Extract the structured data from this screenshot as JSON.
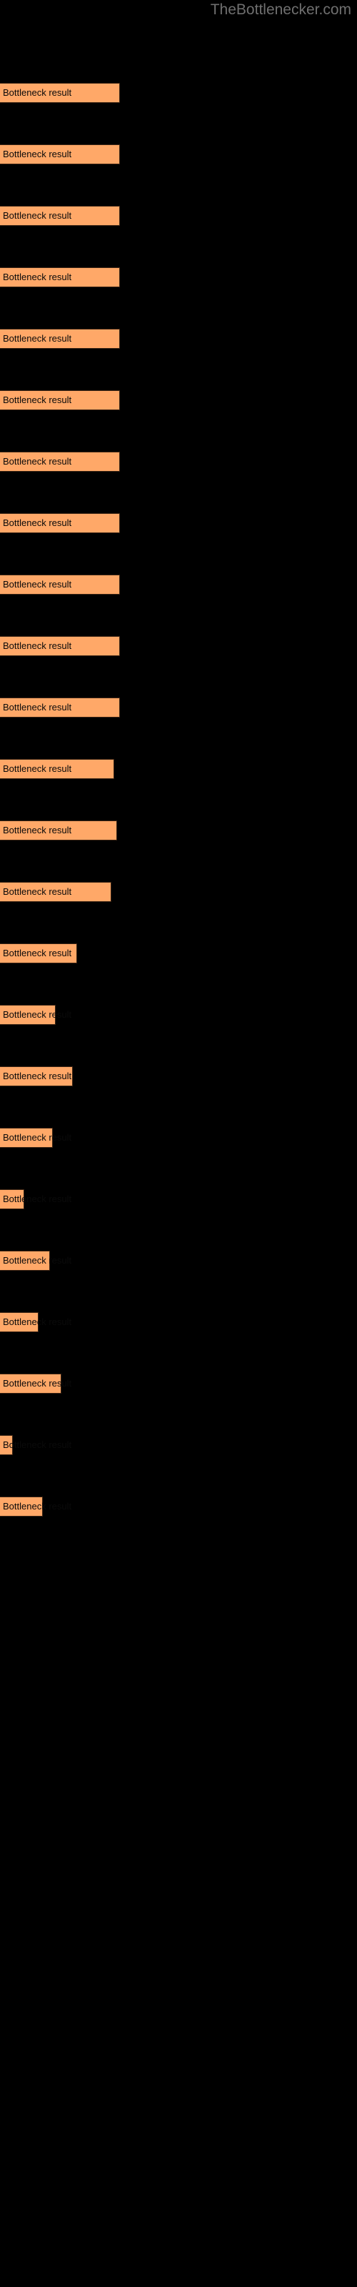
{
  "site": {
    "title": "TheBottlenecker.com",
    "title_color": "#6f6f6f",
    "background_color": "#000000"
  },
  "chart_data": {
    "type": "bar",
    "title": "",
    "subtitle": "",
    "xlabel": "",
    "ylabel": "",
    "orientation": "horizontal",
    "grid": false,
    "legend": null,
    "bar_color": "#ffa868",
    "bar_border_color": "#3a2414",
    "label_color": "#0a0a0a",
    "xlim": [
      0,
      500
    ],
    "categories": [
      "Bottleneck result",
      "Bottleneck result",
      "Bottleneck result",
      "Bottleneck result",
      "Bottleneck result",
      "Bottleneck result",
      "Bottleneck result",
      "Bottleneck result",
      "Bottleneck result",
      "Bottleneck result",
      "Bottleneck result",
      "Bottleneck result",
      "Bottleneck result",
      "Bottleneck result",
      "Bottleneck result",
      "Bottleneck result",
      "Bottleneck result",
      "Bottleneck result",
      "Bottleneck result",
      "Bottleneck result",
      "Bottleneck result",
      "Bottleneck result",
      "Bottleneck result",
      "Bottleneck result"
    ],
    "values": [
      84,
      84,
      84,
      84,
      84,
      84,
      84,
      84,
      84,
      84,
      84,
      80,
      82,
      78,
      54,
      39,
      51,
      37,
      17,
      35,
      27,
      43,
      9,
      30
    ],
    "bars": [
      {
        "label": "Bottleneck result",
        "width": 84,
        "y": 58
      },
      {
        "label": "Bottleneck result",
        "width": 84,
        "y": 101
      },
      {
        "label": "Bottleneck result",
        "width": 84,
        "y": 144
      },
      {
        "label": "Bottleneck result",
        "width": 84,
        "y": 187
      },
      {
        "label": "Bottleneck result",
        "width": 84,
        "y": 230
      },
      {
        "label": "Bottleneck result",
        "width": 84,
        "y": 273
      },
      {
        "label": "Bottleneck result",
        "width": 84,
        "y": 316
      },
      {
        "label": "Bottleneck result",
        "width": 84,
        "y": 359
      },
      {
        "label": "Bottleneck result",
        "width": 84,
        "y": 402
      },
      {
        "label": "Bottleneck result",
        "width": 84,
        "y": 445
      },
      {
        "label": "Bottleneck result",
        "width": 84,
        "y": 488
      },
      {
        "label": "Bottleneck resul",
        "width": 80,
        "y": 531
      },
      {
        "label": "Bottleneck result",
        "width": 82,
        "y": 574
      },
      {
        "label": "Bottleneck resul",
        "width": 78,
        "y": 617
      },
      {
        "label": "Bottleneck r",
        "width": 54,
        "y": 660
      },
      {
        "label": "Bottlene",
        "width": 39,
        "y": 703
      },
      {
        "label": "Bottleneck",
        "width": 51,
        "y": 746
      },
      {
        "label": "Bottle",
        "width": 37,
        "y": 789
      },
      {
        "label": "Bo",
        "width": 17,
        "y": 832
      },
      {
        "label": "Bottle",
        "width": 35,
        "y": 875
      },
      {
        "label": "Bott",
        "width": 27,
        "y": 918
      },
      {
        "label": "Bottlene",
        "width": 43,
        "y": 961
      },
      {
        "label": "B",
        "width": 9,
        "y": 1004
      },
      {
        "label": "Bottle",
        "width": 30,
        "y": 1047
      }
    ]
  }
}
